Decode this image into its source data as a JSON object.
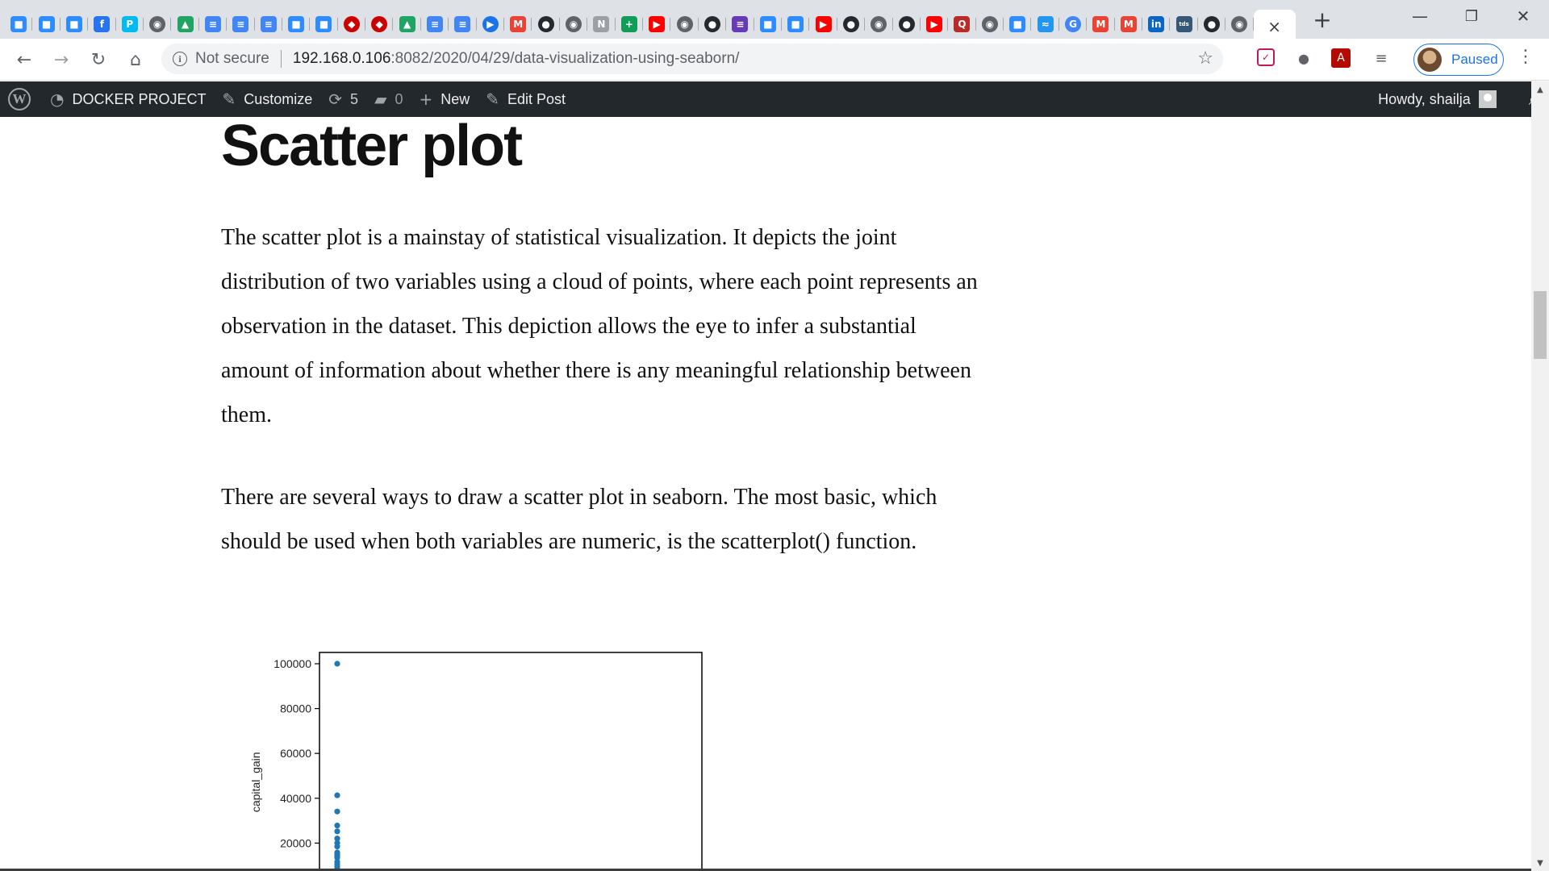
{
  "browser": {
    "tabs": [
      {
        "icon": "zoom-icon",
        "glyph": "■",
        "bg": "#2d8cff",
        "round": false
      },
      {
        "icon": "zoom-icon",
        "glyph": "■",
        "bg": "#2d8cff",
        "round": false
      },
      {
        "icon": "zoom-icon",
        "glyph": "■",
        "bg": "#2d8cff",
        "round": false
      },
      {
        "icon": "flipkart-icon",
        "glyph": "f",
        "bg": "#2874f0",
        "round": false
      },
      {
        "icon": "paytm-icon",
        "glyph": "P",
        "bg": "#00baf2",
        "round": false
      },
      {
        "icon": "globe-icon",
        "glyph": "◉",
        "bg": "#5f6368",
        "round": true
      },
      {
        "icon": "google-drive-icon",
        "glyph": "▲",
        "bg": "#1fa463",
        "round": false
      },
      {
        "icon": "google-docs-icon",
        "glyph": "≡",
        "bg": "#4285f4",
        "round": false
      },
      {
        "icon": "google-docs-icon",
        "glyph": "≡",
        "bg": "#4285f4",
        "round": false
      },
      {
        "icon": "google-docs-icon",
        "glyph": "≡",
        "bg": "#4285f4",
        "round": false
      },
      {
        "icon": "zoom-icon",
        "glyph": "■",
        "bg": "#2d8cff",
        "round": false
      },
      {
        "icon": "zoom-icon",
        "glyph": "■",
        "bg": "#2d8cff",
        "round": false
      },
      {
        "icon": "redhat-icon",
        "glyph": "◆",
        "bg": "#cc0000",
        "round": true
      },
      {
        "icon": "redhat-icon",
        "glyph": "◆",
        "bg": "#cc0000",
        "round": true
      },
      {
        "icon": "google-drive-icon",
        "glyph": "▲",
        "bg": "#1fa463",
        "round": false
      },
      {
        "icon": "google-docs-icon",
        "glyph": "≡",
        "bg": "#4285f4",
        "round": false
      },
      {
        "icon": "google-docs-icon",
        "glyph": "≡",
        "bg": "#4285f4",
        "round": false
      },
      {
        "icon": "google-meet-icon",
        "glyph": "▶",
        "bg": "#1a73e8",
        "round": true
      },
      {
        "icon": "gmail-icon",
        "glyph": "M",
        "bg": "#ea4335",
        "round": false
      },
      {
        "icon": "github-icon",
        "glyph": "●",
        "bg": "#24292e",
        "round": true
      },
      {
        "icon": "globe-icon",
        "glyph": "◉",
        "bg": "#5f6368",
        "round": true
      },
      {
        "icon": "notion-icon",
        "glyph": "N",
        "bg": "#9aa0a6",
        "round": false
      },
      {
        "icon": "google-sheets-icon",
        "glyph": "+",
        "bg": "#0f9d58",
        "round": false
      },
      {
        "icon": "youtube-icon",
        "glyph": "▶",
        "bg": "#ff0000",
        "round": false
      },
      {
        "icon": "globe-icon",
        "glyph": "◉",
        "bg": "#5f6368",
        "round": true
      },
      {
        "icon": "github-icon",
        "glyph": "●",
        "bg": "#24292e",
        "round": true
      },
      {
        "icon": "google-forms-icon",
        "glyph": "≡",
        "bg": "#673ab7",
        "round": false
      },
      {
        "icon": "zoom-icon",
        "glyph": "■",
        "bg": "#2d8cff",
        "round": false
      },
      {
        "icon": "zoom-icon",
        "glyph": "■",
        "bg": "#2d8cff",
        "round": false
      },
      {
        "icon": "youtube-icon",
        "glyph": "▶",
        "bg": "#ff0000",
        "round": false
      },
      {
        "icon": "github-icon",
        "glyph": "●",
        "bg": "#24292e",
        "round": true
      },
      {
        "icon": "globe-icon",
        "glyph": "◉",
        "bg": "#5f6368",
        "round": true
      },
      {
        "icon": "github-icon",
        "glyph": "●",
        "bg": "#24292e",
        "round": true
      },
      {
        "icon": "youtube-icon",
        "glyph": "▶",
        "bg": "#ff0000",
        "round": false
      },
      {
        "icon": "quora-icon",
        "glyph": "Q",
        "bg": "#b92b27",
        "round": false
      },
      {
        "icon": "globe-icon",
        "glyph": "◉",
        "bg": "#5f6368",
        "round": true
      },
      {
        "icon": "zoom-icon",
        "glyph": "■",
        "bg": "#2d8cff",
        "round": false
      },
      {
        "icon": "docker-icon",
        "glyph": "≈",
        "bg": "#2496ed",
        "round": false
      },
      {
        "icon": "google-icon",
        "glyph": "G",
        "bg": "#4285f4",
        "round": true
      },
      {
        "icon": "gmail-icon",
        "glyph": "M",
        "bg": "#ea4335",
        "round": false
      },
      {
        "icon": "gmail-icon",
        "glyph": "M",
        "bg": "#ea4335",
        "round": false
      },
      {
        "icon": "linkedin-icon",
        "glyph": "in",
        "bg": "#0a66c2",
        "round": false
      },
      {
        "icon": "tds-icon",
        "glyph": "tds",
        "bg": "#355876",
        "round": false
      },
      {
        "icon": "github-icon",
        "glyph": "●",
        "bg": "#24292e",
        "round": true
      },
      {
        "icon": "globe-icon",
        "glyph": "◉",
        "bg": "#5f6368",
        "round": true
      }
    ],
    "active_tab_close": "×",
    "new_tab": "+",
    "minimize": "—",
    "restore": "❐",
    "close": "✕",
    "back": "←",
    "forward": "→",
    "reload": "↻",
    "home": "⌂",
    "security_label": "Not secure",
    "url_host": "192.168.0.106",
    "url_path": ":8082/2020/04/29/data-visualization-using-seaborn/",
    "bookmark_star": "☆",
    "profile_label": "Paused",
    "menu": "⋮"
  },
  "admin_bar": {
    "wp_logo": "W",
    "site_name": "DOCKER PROJECT",
    "customize": "Customize",
    "updates_count": "5",
    "comments_count": "0",
    "new": "New",
    "edit_post": "Edit Post",
    "howdy": "Howdy, shailja"
  },
  "post": {
    "title": "Scatter plot",
    "paragraph1": "The scatter plot is a mainstay of statistical visualization. It depicts the joint distribution of two variables using a cloud of points, where each point represents an observation in the dataset. This depiction allows the eye to infer a substantial amount of information about whether there is any meaningful relationship between them.",
    "paragraph2": "There are several ways to draw a scatter plot in seaborn. The most basic, which should be used when both variables are numeric, is the scatterplot() function."
  },
  "colors": {
    "point": "#1f77b4",
    "admin_bar_bg": "#23282d",
    "link_blue": "#1a73e8"
  },
  "chart_data": {
    "type": "scatter",
    "ylabel": "capital_gain",
    "yticks": [
      100000,
      80000,
      60000,
      40000,
      20000
    ],
    "yticklabels": [
      "100000",
      "80000",
      "60000",
      "40000",
      "20000"
    ],
    "ylim": [
      5000,
      104000
    ],
    "points": [
      {
        "y": 99999
      },
      {
        "y": 41310
      },
      {
        "y": 34095
      },
      {
        "y": 27828
      },
      {
        "y": 25236
      },
      {
        "y": 22040
      },
      {
        "y": 20051
      },
      {
        "y": 18481
      },
      {
        "y": 15831
      },
      {
        "y": 15024
      },
      {
        "y": 14344
      },
      {
        "y": 13550
      },
      {
        "y": 11678
      },
      {
        "y": 10605
      },
      {
        "y": 9562
      },
      {
        "y": 8614
      },
      {
        "y": 7688
      }
    ]
  }
}
